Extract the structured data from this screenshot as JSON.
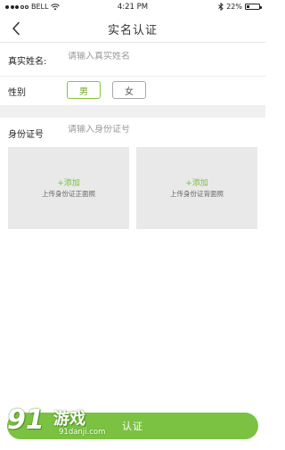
{
  "status_bar": {
    "carrier": "BELL",
    "time": "4:21 PM",
    "battery": "22%",
    "battery_level": 0.22
  },
  "header": {
    "back_icon": "chevron-left-icon",
    "title": "实名认证"
  },
  "form": {
    "name": {
      "label": "真实姓名:",
      "placeholder": "请输入真实姓名"
    },
    "gender": {
      "label": "性别",
      "options": [
        "男",
        "女"
      ],
      "selected": "男"
    },
    "id_number": {
      "label": "身份证号",
      "placeholder": "请输入身份证号"
    }
  },
  "uploads": [
    {
      "add_label": "+添加",
      "description": "上传身份证正面照"
    },
    {
      "add_label": "+添加",
      "description": "上传身份证背面照"
    }
  ],
  "submit_label": "认证",
  "watermark": {
    "mark": "91",
    "text": "游戏",
    "url": "91danji.com"
  },
  "colors": {
    "accent": "#7bc242",
    "accent_text": "#6cab1f",
    "section_band": "#f0f0f0",
    "upload_bg": "#e9e9e9"
  }
}
